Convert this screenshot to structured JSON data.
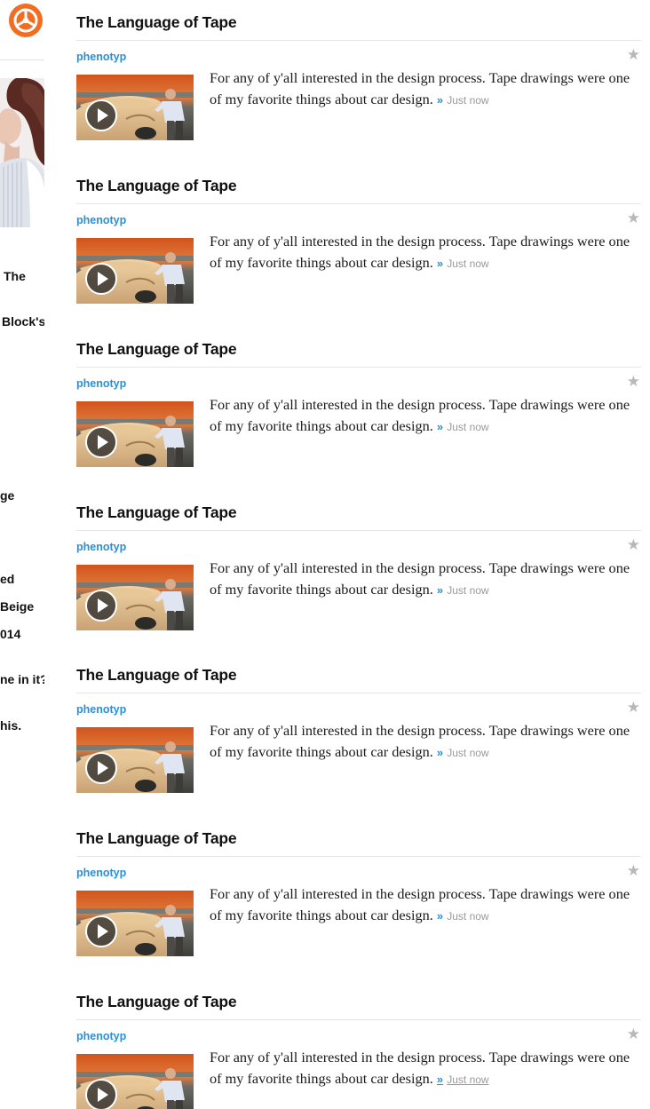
{
  "colors": {
    "accent": "#2a8fd8",
    "brand": "#f26d21",
    "star": "#b8b8b8",
    "timestamp": "#999999"
  },
  "sidebar": {
    "logo_icon": "brand-logo-icon",
    "fragments": [
      "The",
      "Block's",
      "ge",
      "ed",
      "Beige",
      "014",
      "ne in it?",
      "his."
    ]
  },
  "posts": [
    {
      "title": "The Language of Tape",
      "author": "phenotyp",
      "text": "For any of y'all interested in the design process. Tape drawings were one of my favorite things about car design.",
      "more": "»",
      "timestamp": "Just now",
      "thumbnail_icon": "video-thumbnail",
      "play_icon": "play-icon",
      "star_icon": "star-icon"
    },
    {
      "title": "The Language of Tape",
      "author": "phenotyp",
      "text": "For any of y'all interested in the design process. Tape drawings were one of my favorite things about car design.",
      "more": "»",
      "timestamp": "Just now",
      "thumbnail_icon": "video-thumbnail",
      "play_icon": "play-icon",
      "star_icon": "star-icon"
    },
    {
      "title": "The Language of Tape",
      "author": "phenotyp",
      "text": "For any of y'all interested in the design process. Tape drawings were one of my favorite things about car design.",
      "more": "»",
      "timestamp": "Just now",
      "thumbnail_icon": "video-thumbnail",
      "play_icon": "play-icon",
      "star_icon": "star-icon"
    },
    {
      "title": "The Language of Tape",
      "author": "phenotyp",
      "text": "For any of y'all interested in the design process. Tape drawings were one of my favorite things about car design.",
      "more": "»",
      "timestamp": "Just now",
      "thumbnail_icon": "video-thumbnail",
      "play_icon": "play-icon",
      "star_icon": "star-icon"
    },
    {
      "title": "The Language of Tape",
      "author": "phenotyp",
      "text": "For any of y'all interested in the design process. Tape drawings were one of my favorite things about car design.",
      "more": "»",
      "timestamp": "Just now",
      "thumbnail_icon": "video-thumbnail",
      "play_icon": "play-icon",
      "star_icon": "star-icon"
    },
    {
      "title": "The Language of Tape",
      "author": "phenotyp",
      "text": "For any of y'all interested in the design process. Tape drawings were one of my favorite things about car design.",
      "more": "»",
      "timestamp": "Just now",
      "thumbnail_icon": "video-thumbnail",
      "play_icon": "play-icon",
      "star_icon": "star-icon"
    },
    {
      "title": "The Language of Tape",
      "author": "phenotyp",
      "text": "For any of y'all interested in the design process. Tape drawings were one of my favorite things about car design.",
      "more": "»",
      "timestamp": "Just now",
      "thumbnail_icon": "video-thumbnail",
      "play_icon": "play-icon",
      "star_icon": "star-icon"
    }
  ]
}
